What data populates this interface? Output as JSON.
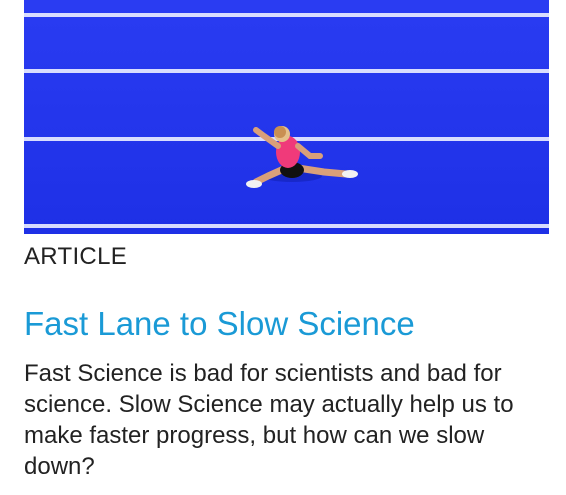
{
  "article": {
    "image_alt": "Aerial view of a sprinter on a blue running track",
    "category": "ARTICLE",
    "title": "Fast Lane to Slow Science",
    "summary": "Fast Science is bad for scientists and bad for science. Slow Science may actually help us to make faster progress, but how can we slow down?"
  },
  "colors": {
    "title": "#1a9ad6",
    "track": "#2233ee",
    "lane_lines": "#e8ecff",
    "text": "#222222"
  }
}
